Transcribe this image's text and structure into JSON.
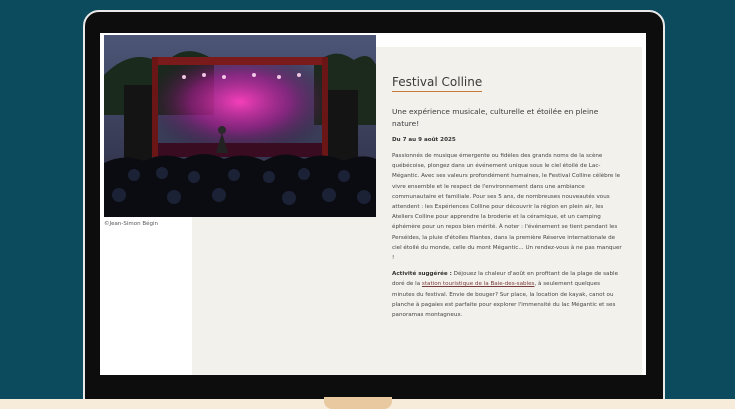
{
  "article": {
    "title": "Festival Colline",
    "subtitle": "Une expérience musicale, culturelle et étoilée en pleine nature!",
    "dates": "Du 7 au 9 août 2025",
    "paragraph": "Passionnés de musique émergente ou fidèles des grands noms de la scène québécoise, plongez dans un événement unique sous le ciel étoilé de Lac-Mégantic. Avec ses valeurs profondément humaines, le Festival Colline célèbre le vivre ensemble et le respect de l'environnement dans une ambiance communautaire et familiale. Pour ses 5 ans, de nombreuses nouveautés vous attendent : les Expériences Colline pour découvrir la région en plein air, les Ateliers Colline pour apprendre la broderie et la céramique, et un camping éphémère pour un repos bien mérité. À noter : l'événement se tient pendant les Perséides, la pluie d'étoiles filantes, dans la première Réserve internationale de ciel étoilé du monde, celle du mont Mégantic... Un rendez-vous à ne pas manquer !",
    "activity_label": "Activité suggérée :",
    "activity_text_before": " Déjouez la chaleur d'août en profitant de la plage de sable doré de la ",
    "activity_link": "station touristique de la Baie-des-sables",
    "activity_text_after": ", à seulement quelques minutes du festival. Envie de bouger? Sur place, la location de kayak, canot ou planche à pagaies est parfaite pour explorer l'immensité du lac Mégantic et ses panoramas montagneux."
  },
  "photo": {
    "caption": "©Jean-Simon Bégin"
  }
}
